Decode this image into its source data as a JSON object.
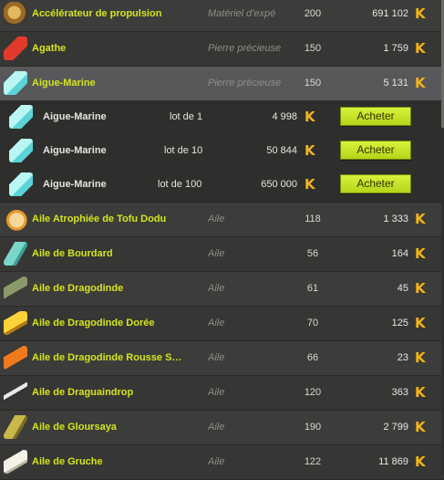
{
  "currency_symbol": "K",
  "buy_label": "Acheter",
  "items": [
    {
      "name": "Accélérateur de propulsion",
      "category": "Matériel d'expé",
      "level": "200",
      "price": "691 102",
      "icon": "accelerator-icon"
    },
    {
      "name": "Agathe",
      "category": "Pierre précieuse",
      "level": "150",
      "price": "1 759",
      "icon": "agate-gem-icon"
    },
    {
      "name": "Aigue-Marine",
      "category": "Pierre précieuse",
      "level": "150",
      "price": "5 131",
      "icon": "aquamarine-gem-icon",
      "selected": true
    }
  ],
  "lots": [
    {
      "name": "Aigue-Marine",
      "lot": "lot de 1",
      "price": "4 998"
    },
    {
      "name": "Aigue-Marine",
      "lot": "lot de 10",
      "price": "50 844"
    },
    {
      "name": "Aigue-Marine",
      "lot": "lot de 100",
      "price": "650 000"
    }
  ],
  "items2": [
    {
      "name": "Aile Atrophiée de Tofu Dodu",
      "category": "Aile",
      "level": "118",
      "price": "1 333",
      "icon": "tofu-wing-icon"
    },
    {
      "name": "Aile de Bourdard",
      "category": "Aile",
      "level": "56",
      "price": "164",
      "icon": "bourdard-wing-icon"
    },
    {
      "name": "Aile de Dragodinde",
      "category": "Aile",
      "level": "61",
      "price": "45",
      "icon": "dragodinde-wing-icon"
    },
    {
      "name": "Aile de Dragodinde Dorée",
      "category": "Aile",
      "level": "70",
      "price": "125",
      "icon": "golden-dragodinde-wing-icon"
    },
    {
      "name": "Aile de Dragodinde Rousse S…",
      "category": "Aile",
      "level": "66",
      "price": "23",
      "icon": "red-dragodinde-wing-icon"
    },
    {
      "name": "Aile de Draguaindrop",
      "category": "Aile",
      "level": "120",
      "price": "363",
      "icon": "draguaindrop-wing-icon"
    },
    {
      "name": "Aile de Gloursaya",
      "category": "Aile",
      "level": "190",
      "price": "2 799",
      "icon": "gloursaya-wing-icon"
    },
    {
      "name": "Aile de Gruche",
      "category": "Aile",
      "level": "122",
      "price": "11 869",
      "icon": "gruche-wing-icon"
    }
  ]
}
